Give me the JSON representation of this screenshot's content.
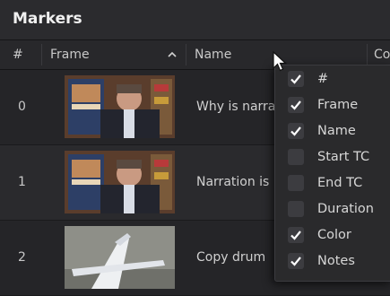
{
  "panel": {
    "title": "Markers"
  },
  "columns": {
    "num": "#",
    "frame": "Frame",
    "name": "Name",
    "color_partial": "Co"
  },
  "rows": [
    {
      "num": "0",
      "name": "Why is narra"
    },
    {
      "num": "1",
      "name": "Narration is"
    },
    {
      "num": "2",
      "name": "Copy drum"
    }
  ],
  "menu": {
    "items": [
      {
        "label": "#",
        "checked": true
      },
      {
        "label": "Frame",
        "checked": true
      },
      {
        "label": "Name",
        "checked": true
      },
      {
        "label": "Start TC",
        "checked": false
      },
      {
        "label": "End TC",
        "checked": false
      },
      {
        "label": "Duration",
        "checked": false
      },
      {
        "label": "Color",
        "checked": true
      },
      {
        "label": "Notes",
        "checked": true
      }
    ]
  },
  "colors": {
    "marker": "#b23a6a",
    "accent": "#ffffff"
  },
  "icons": {
    "sort": "chevron-up-icon",
    "check": "check-icon",
    "cursor": "mouse-pointer-icon"
  }
}
